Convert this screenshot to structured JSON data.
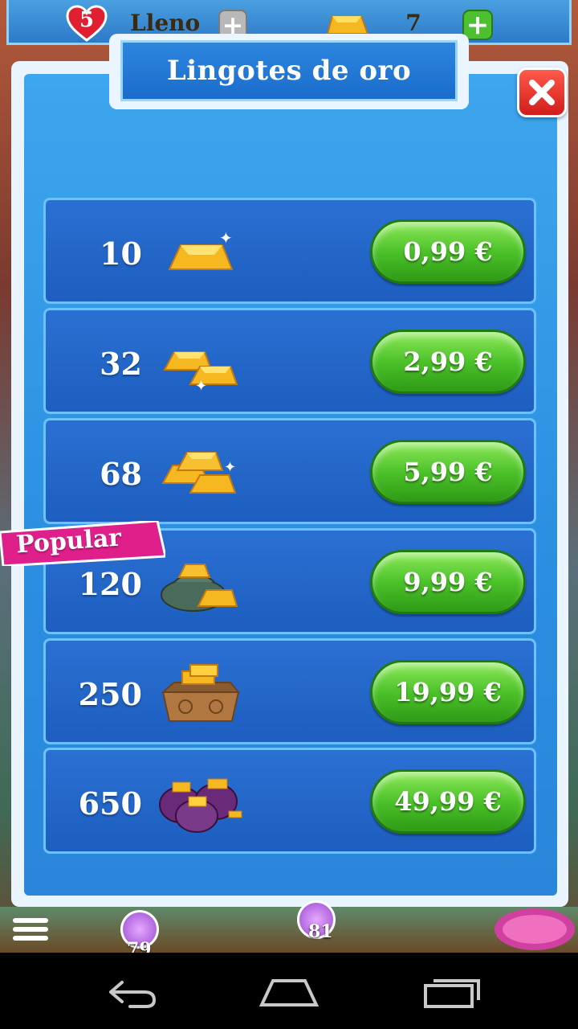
{
  "topbar": {
    "lives_count": "5",
    "lives_status": "Lleno",
    "gold_count": "7"
  },
  "dialog": {
    "title": "Lingotes de oro",
    "popular_label": "Popular",
    "packages": [
      {
        "quantity": "10",
        "price": "0,99 €",
        "icon": "gold-bar-icon"
      },
      {
        "quantity": "32",
        "price": "2,99 €",
        "icon": "gold-bars-pair-icon"
      },
      {
        "quantity": "68",
        "price": "5,99 €",
        "icon": "gold-bars-stack-icon"
      },
      {
        "quantity": "120",
        "price": "9,99 €",
        "icon": "gold-sack-icon"
      },
      {
        "quantity": "250",
        "price": "19,99 €",
        "icon": "gold-chest-icon"
      },
      {
        "quantity": "650",
        "price": "49,99 €",
        "icon": "gold-cauldrons-icon"
      }
    ]
  },
  "map": {
    "level_numbers": [
      "79",
      "81"
    ]
  },
  "navbar": {
    "icons": [
      "back-icon",
      "home-icon",
      "recent-apps-icon"
    ]
  },
  "colors": {
    "panel_blue": "#2b8ee0",
    "row_blue": "#1d5ec0",
    "price_green": "#4cc22a",
    "close_red": "#d21c1c",
    "popular_pink": "#e0208a"
  }
}
